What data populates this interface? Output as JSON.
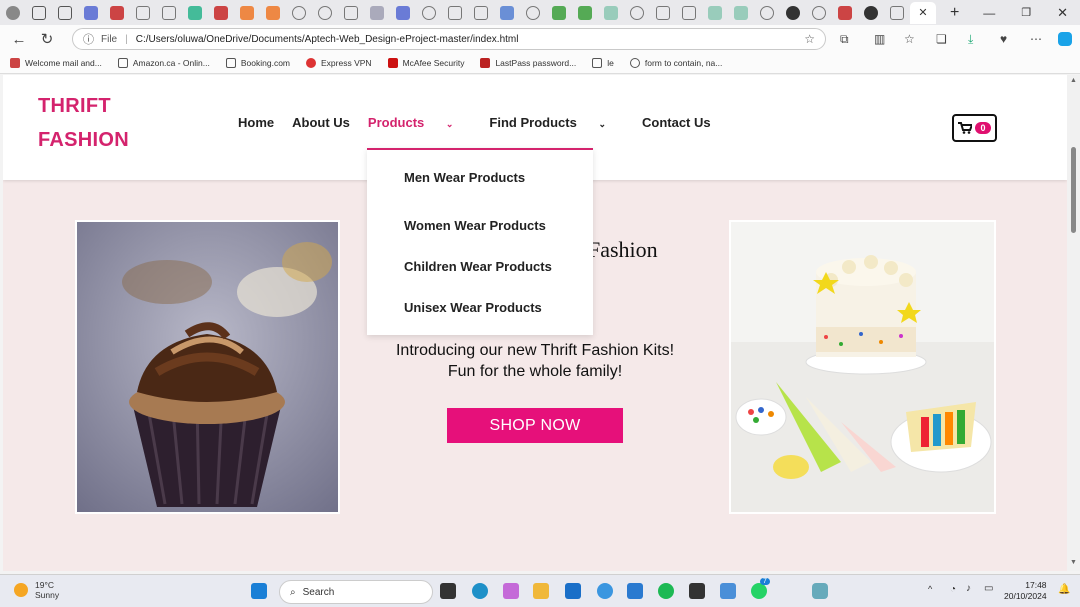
{
  "browser": {
    "address": {
      "scheme_label": "File",
      "url": "C:/Users/oluwa/OneDrive/Documents/Aptech-Web_Design-eProject-master/index.html"
    },
    "bookmarks": [
      "Welcome mail and...",
      "Amazon.ca - Onlin...",
      "Booking.com",
      "Express VPN",
      "McAfee Security",
      "LastPass password...",
      "le",
      "form to contain, na..."
    ]
  },
  "site": {
    "logo_line1": "THRIFT",
    "logo_line2": "FASHION",
    "nav": {
      "home": "Home",
      "about": "About Us",
      "products": "Products",
      "find_products": "Find Products",
      "contact": "Contact Us"
    },
    "cart_count": "0",
    "dropdown": [
      "Men Wear Products",
      "Women Wear Products",
      "Children Wear Products",
      "Unisex Wear Products"
    ],
    "hero": {
      "title_partial": "Fashion",
      "text": "Introducing our new Thrift Fashion Kits! Fun for the whole family!",
      "cta": "SHOP NOW"
    },
    "accent_color": "#d4236d",
    "button_color": "#e6107a"
  },
  "taskbar": {
    "weather_temp": "19°C",
    "weather_desc": "Sunny",
    "search_placeholder": "Search",
    "time": "17:48",
    "date": "20/10/2024",
    "badge": "7"
  }
}
